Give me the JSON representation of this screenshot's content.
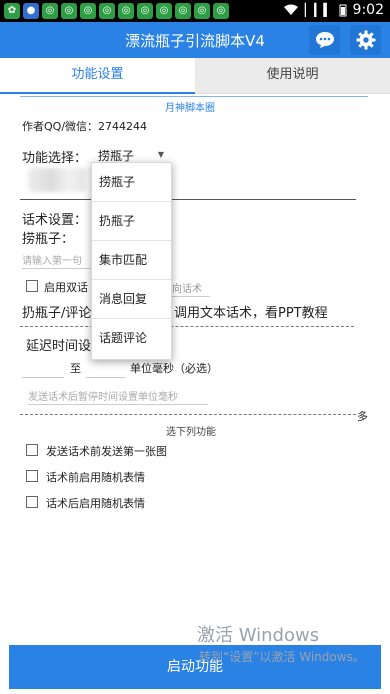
{
  "status": {
    "time": "9:02",
    "signal": "▏▎▍"
  },
  "header": {
    "title": "漂流瓶子引流脚本V4"
  },
  "tabs": [
    {
      "label": "功能设置"
    },
    {
      "label": "使用说明"
    }
  ],
  "section_header": "月神脚本圈",
  "author": "作者QQ/微信：2744244",
  "function_select": {
    "label": "功能选择：",
    "value": "捞瓶子"
  },
  "dropdown_options": [
    "捞瓶子",
    "扔瓶子",
    "集市匹配",
    "消息回复",
    "话题评论"
  ],
  "script_settings": {
    "label": "话术设置：",
    "sublabel": "捞瓶子：",
    "input_placeholder": "请输入第一句",
    "dual_label": "启用双话",
    "dual_hint": "向话术",
    "note_left": "扔瓶子/评论",
    "note_right": "调用文本话术，看PPT教程"
  },
  "delay": {
    "label": "延迟时间设",
    "to": "至",
    "unit": "单位毫秒（必选）",
    "pause_placeholder": "发送话术后暂停时间设置单位毫秒"
  },
  "more_marker": "多",
  "options_label": "选下列功能",
  "checkboxes": [
    {
      "label": "发送话术前发送第一张图"
    },
    {
      "label": "话术前启用随机表情"
    },
    {
      "label": "话术后启用随机表情"
    }
  ],
  "watermark": {
    "line1": "激活 Windows",
    "line2": "转到“设置”以激活 Windows。"
  },
  "start_button": "启动功能"
}
